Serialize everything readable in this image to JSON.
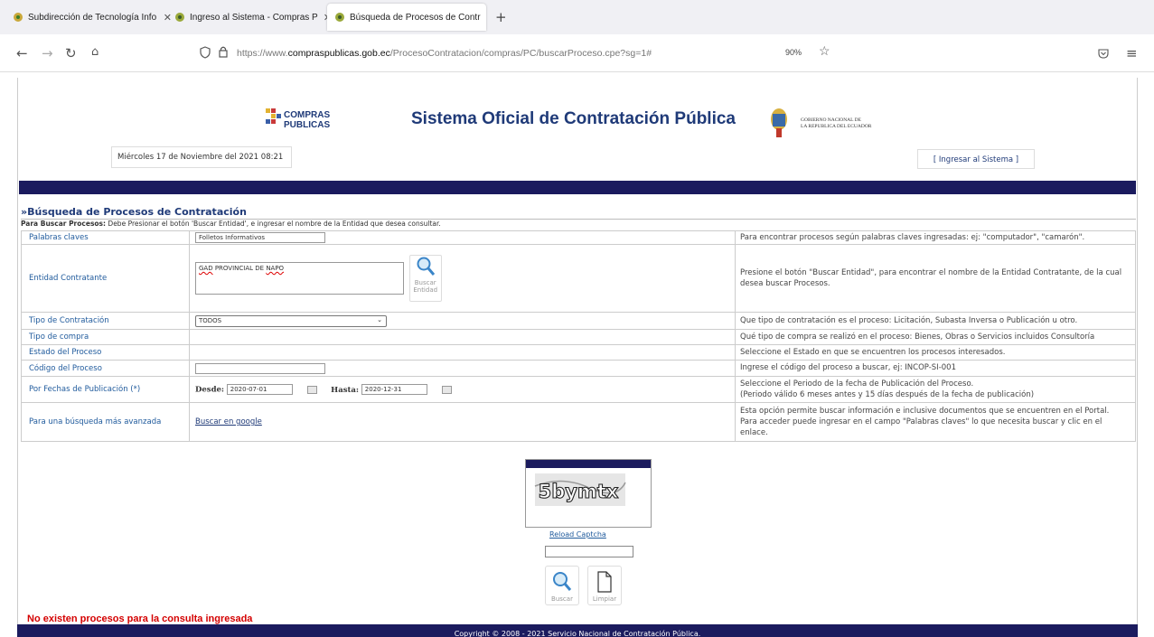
{
  "browser": {
    "tabs": [
      {
        "label": "Subdirección de Tecnología Info",
        "color": "#b9a23a"
      },
      {
        "label": "Ingreso al Sistema - Compras P",
        "color": "#8a9b2a"
      },
      {
        "label": "Búsqueda de Procesos de Contr",
        "color": "#8a9b2a"
      }
    ],
    "url_prefix": "https://www.",
    "url_host": "compraspublicas.gob.ec",
    "url_path": "/ProcesoContratacion/compras/PC/buscarProceso.cpe?sg=1#",
    "zoom": "90%"
  },
  "header": {
    "cp_logo_line1": "COMPRAS",
    "cp_logo_line2": "PUBLICAS",
    "site_title": "Sistema Oficial de Contratación Pública",
    "gob_line1": "GOBIERNO NACIONAL DE",
    "gob_line2": "LA REPUBLICA DEL ECUADOR",
    "date": "Miércoles 17 de Noviembre del 2021 08:21",
    "login_link": "[ Ingresar al Sistema ]"
  },
  "search": {
    "title": "»Búsqueda de Procesos de Contratación",
    "instr_bold": "Para Buscar Procesos:",
    "instr_text": " Debe Presionar el botón 'Buscar Entidad', e ingresar el nombre de la Entidad que desea consultar.",
    "keywords_label": "Palabras claves",
    "keywords_value": "Folletos Informativos",
    "keywords_help": "Para encontrar procesos según palabras claves ingresadas: ej: \"computador\", \"camarón\".",
    "entity_label": "Entidad Contratante",
    "entity_value_a": "GAD",
    "entity_value_b": " PROVINCIAL DE ",
    "entity_value_c": "NAPO",
    "entity_btn": "Buscar Entidad",
    "entity_help": "Presione el botón \"Buscar Entidad\", para encontrar el nombre de la Entidad Contratante, de la cual desea buscar Procesos.",
    "type_label": "Tipo de Contratación",
    "type_value": "TODOS",
    "type_help": "Que tipo de contratación es el proceso: Licitación, Subasta Inversa o Publicación u otro.",
    "purchase_label": "Tipo de compra",
    "purchase_help": "Qué tipo de compra se realizó en el proceso: Bienes, Obras o Servicios incluidos Consultoría",
    "state_label": "Estado del Proceso",
    "state_help": "Seleccione el Estado en que se encuentren los procesos interesados.",
    "code_label": "Código del Proceso",
    "code_help": "Ingrese el código del proceso a buscar, ej: INCOP-SI-001",
    "dates_label": "Por Fechas de Publicación (*)",
    "from_label": "Desde:",
    "from_value": "2020-07-01",
    "to_label": "Hasta:",
    "to_value": "2020-12-31",
    "dates_help_1": "Seleccione el Periodo de la fecha de Publicación del Proceso.",
    "dates_help_2": "(Periodo válido 6 meses antes y 15 días después de la fecha de publicación)",
    "advanced_label": "Para una búsqueda más avanzada",
    "advanced_link": "Buscar en google",
    "advanced_help": "Esta opción permite buscar información e inclusive documentos que se encuentren en el Portal. Para acceder puede ingresar en el campo \"Palabras claves\" lo que necesita buscar y clic en el enlace."
  },
  "captcha": {
    "text": "5bymtx",
    "reload": "Reload Captcha",
    "search_btn": "Buscar",
    "clear_btn": "Limpiar"
  },
  "result_message": "No existen procesos para la consulta ingresada",
  "footer": "Copyright © 2008 - 2021 Servicio Nacional de Contratación Pública."
}
